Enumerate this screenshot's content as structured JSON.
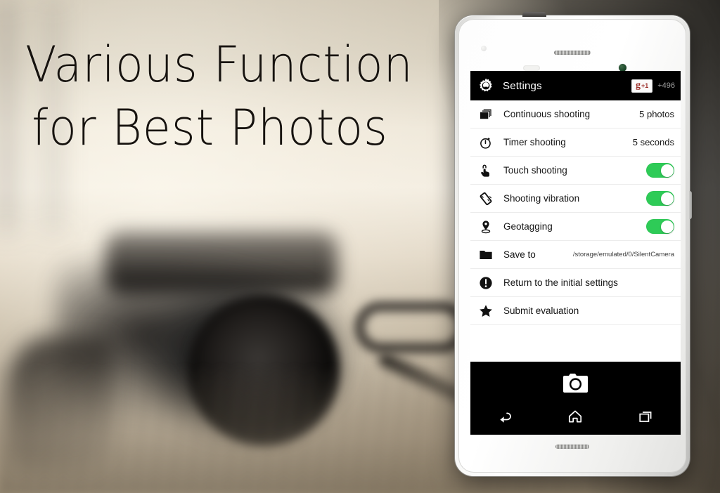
{
  "promo": {
    "headline_line1": "Various Function",
    "headline_line2": "for Best Photos"
  },
  "appbar": {
    "title": "Settings",
    "gear_icon": "gear-icon",
    "gplus_g": "g",
    "gplus_plus": "+1",
    "gplus_count": "+496"
  },
  "settings": [
    {
      "icon": "photo-stack-icon",
      "label": "Continuous shooting",
      "value": "5 photos",
      "type": "value"
    },
    {
      "icon": "timer-icon",
      "label": "Timer shooting",
      "value": "5 seconds",
      "type": "value"
    },
    {
      "icon": "touch-hand-icon",
      "label": "Touch shooting",
      "value": "on",
      "type": "toggle"
    },
    {
      "icon": "vibration-icon",
      "label": "Shooting vibration",
      "value": "on",
      "type": "toggle"
    },
    {
      "icon": "location-pin-icon",
      "label": "Geotagging",
      "value": "on",
      "type": "toggle"
    },
    {
      "icon": "folder-icon",
      "label": "Save to",
      "value": "/storage/emulated/0/SilentCamera",
      "type": "path"
    },
    {
      "icon": "exclamation-icon",
      "label": "Return to the initial settings",
      "value": "",
      "type": "plain"
    },
    {
      "icon": "star-icon",
      "label": "Submit evaluation",
      "value": "",
      "type": "plain"
    }
  ],
  "viewfinder": {
    "shutter_icon": "camera-shutter-icon",
    "nav_back_icon": "back-arrow-icon",
    "nav_home_icon": "home-icon",
    "nav_recents_icon": "recents-icon"
  },
  "colors": {
    "toggle_on": "#2ecb57",
    "appbar_bg": "#000000",
    "gplus_red": "#9c2f2a",
    "headline": "#17130f"
  }
}
